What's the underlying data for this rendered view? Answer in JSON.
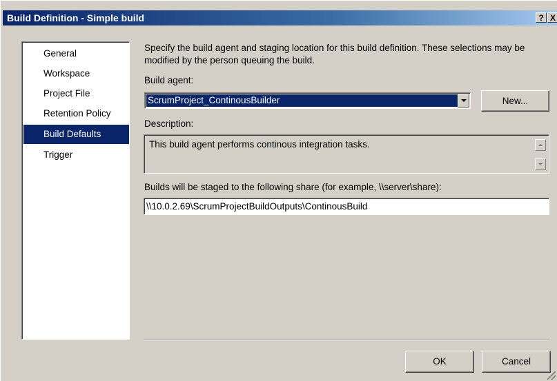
{
  "window": {
    "title": "Build Definition - Simple build",
    "help_glyph": "?",
    "close_glyph": "X"
  },
  "nav": {
    "items": [
      {
        "label": "General",
        "selected": false
      },
      {
        "label": "Workspace",
        "selected": false
      },
      {
        "label": "Project File",
        "selected": false
      },
      {
        "label": "Retention Policy",
        "selected": false
      },
      {
        "label": "Build Defaults",
        "selected": true
      },
      {
        "label": "Trigger",
        "selected": false
      }
    ]
  },
  "content": {
    "intro": "Specify the build agent and staging location for this build definition. These selections may be modified by the person queuing the build.",
    "build_agent_label": "Build agent:",
    "build_agent_value": "ScrumProject_ContinousBuilder",
    "new_button": "New...",
    "description_label": "Description:",
    "description_value": "This build agent performs continous integration tasks.",
    "share_label": "Builds will be staged to the following share (for example, \\\\server\\share):",
    "share_value": "\\\\10.0.2.69\\ScrumProjectBuildOutputs\\ContinousBuild"
  },
  "footer": {
    "ok_button": "OK",
    "cancel_button": "Cancel"
  },
  "colors": {
    "dialog_face": "#d4d0c8",
    "selection": "#0a246a",
    "title_gradient_start": "#0a246a",
    "title_gradient_end": "#a6caf0"
  }
}
